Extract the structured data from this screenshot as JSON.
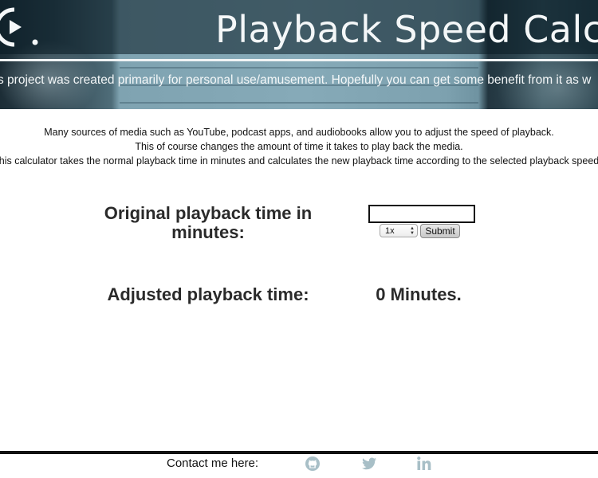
{
  "header": {
    "logo_letter": "C.",
    "title": "Playback Speed Calcula",
    "tagline": "s project was created primarily for personal use/amusement. Hopefully you can get some benefit from it as w"
  },
  "intro": {
    "line1": "Many sources of media such as YouTube, podcast apps, and audiobooks allow you to adjust the speed of playback.",
    "line2": "This of course changes the amount of time it takes to play back the media.",
    "line3": "his calculator takes the normal playback time in minutes and calculates the new playback time according to the selected playback speed"
  },
  "form": {
    "original_label": "Original playback time in minutes:",
    "time_value": "",
    "speed_selected": "1x",
    "submit_label": "Submit",
    "adjusted_label": "Adjusted playback time:",
    "result": "0 Minutes."
  },
  "footer": {
    "contact_label": "Contact me here:",
    "icons": [
      "github-icon",
      "twitter-icon",
      "linkedin-icon"
    ],
    "icon_color": "#a8bfc7"
  },
  "colors": {
    "banner_teal": "#86aab8",
    "banner_dark": "#1c2d36",
    "text": "#2a2a2a"
  }
}
